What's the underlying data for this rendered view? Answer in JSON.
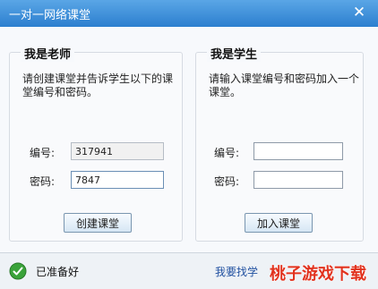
{
  "window": {
    "title": "一对一网络课堂",
    "close_label": "✕"
  },
  "teacher": {
    "title": "我是老师",
    "description": "请创建课堂并告诉学生以下的课堂编号和密码。",
    "number_label": "编号:",
    "number_value": "317941",
    "password_label": "密码:",
    "password_value": "7847",
    "create_button": "创建课堂"
  },
  "student": {
    "title": "我是学生",
    "description": "请输入课堂编号和密码加入一个课堂。",
    "number_label": "编号:",
    "number_value": "",
    "password_label": "密码:",
    "password_value": "",
    "join_button": "加入课堂"
  },
  "status": {
    "text": "已准备好",
    "link_text": "我要找学",
    "watermark": "桃子游戏下载"
  },
  "colors": {
    "titlebar": "#2c7fcf",
    "status_ok": "#3aa33a",
    "watermark": "#e1321e"
  }
}
